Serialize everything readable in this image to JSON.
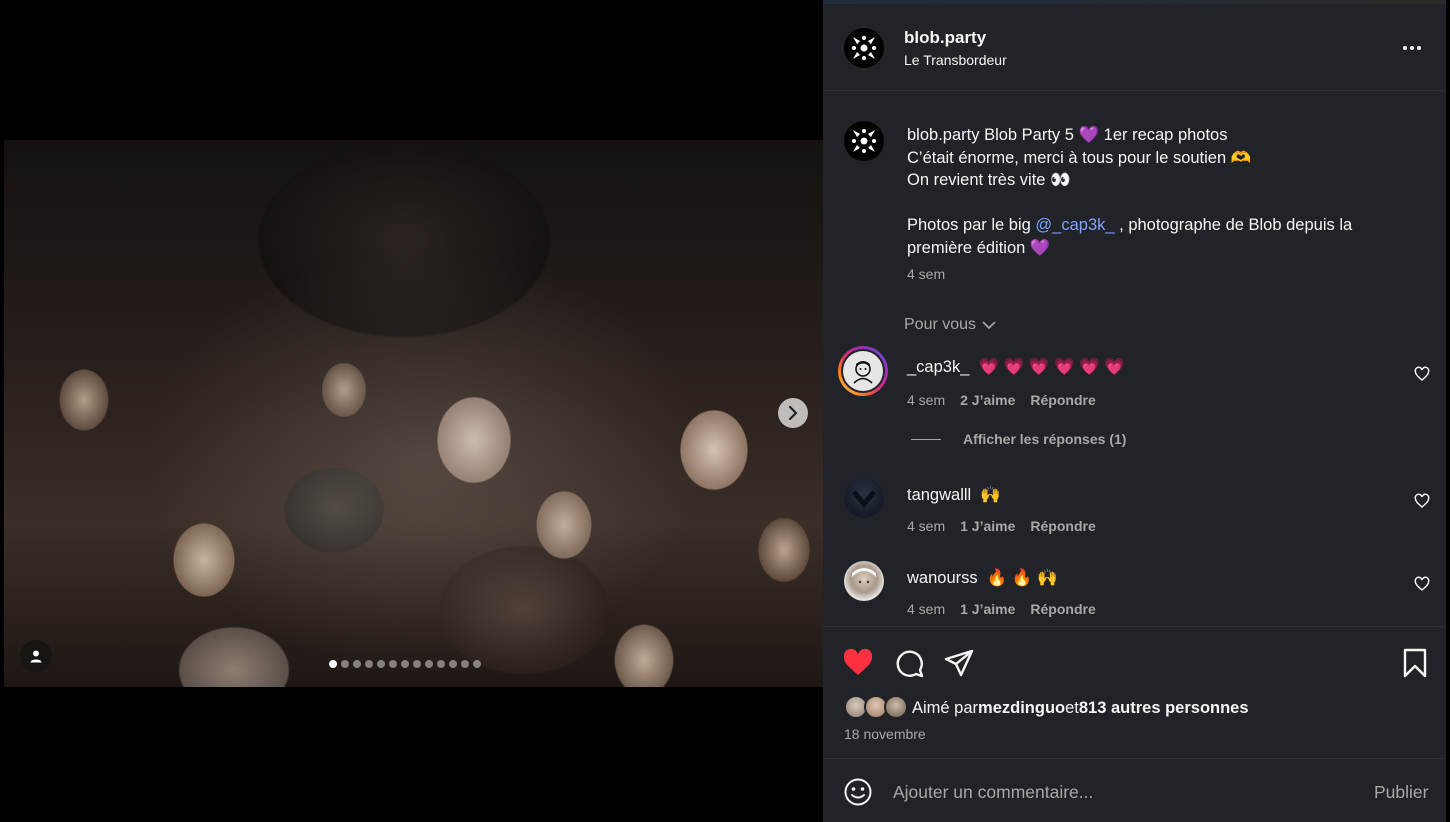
{
  "post": {
    "username": "blob.party",
    "location": "Le Transbordeur",
    "caption": {
      "line1_user": "blob.party",
      "line1_text": "Blob Party 5 💜  1er recap photos",
      "line2": "C’était énorme, merci à tous pour le soutien 🫶",
      "line3": "On revient très vite 👀",
      "line5_before": "Photos par le big ",
      "line5_mention": "@_cap3k_",
      "line5_after": " , photographe de Blob depuis la",
      "line6": "première édition 💜",
      "time": "4 sem"
    },
    "pour_vous": "Pour vous",
    "comments": [
      {
        "user": "_cap3k_",
        "text": "💗 💗 💗 💗 💗 💗",
        "time": "4 sem",
        "likes": "2 J’aime",
        "reply": "Répondre",
        "avatar_color": "#e6e6e6",
        "story_ring": true
      },
      {
        "user": "tangwalll",
        "text": "🙌",
        "time": "4 sem",
        "likes": "1 J’aime",
        "reply": "Répondre",
        "avatar_color": "#1b2230",
        "story_ring": false
      },
      {
        "user": "wanourss",
        "text": "🔥 🔥 🙌",
        "time": "4 sem",
        "likes": "1 J’aime",
        "reply": "Répondre",
        "avatar_color": "#c9c1b6",
        "story_ring": false
      }
    ],
    "view_replies": "Afficher les réponses (1)",
    "likes": {
      "prefix": "Aimé par ",
      "user": "mezdinguo",
      "middle": " et ",
      "others": "813 autres personnes"
    },
    "date": "18 novembre",
    "composer": {
      "placeholder": "Ajouter un commentaire...",
      "publish": "Publier"
    },
    "carousel": {
      "slides": 13,
      "current": 1
    }
  },
  "colors": {
    "panel_bg": "#212328",
    "like_red": "#ff3040",
    "link_blue": "#7fa3ff",
    "muted": "#a8a8a8"
  },
  "icons": [
    "like-heart-icon",
    "comment-icon",
    "share-icon",
    "save-bookmark-icon",
    "emoji-icon",
    "user-tag-icon",
    "chevron-right-icon",
    "more-options-icon"
  ]
}
